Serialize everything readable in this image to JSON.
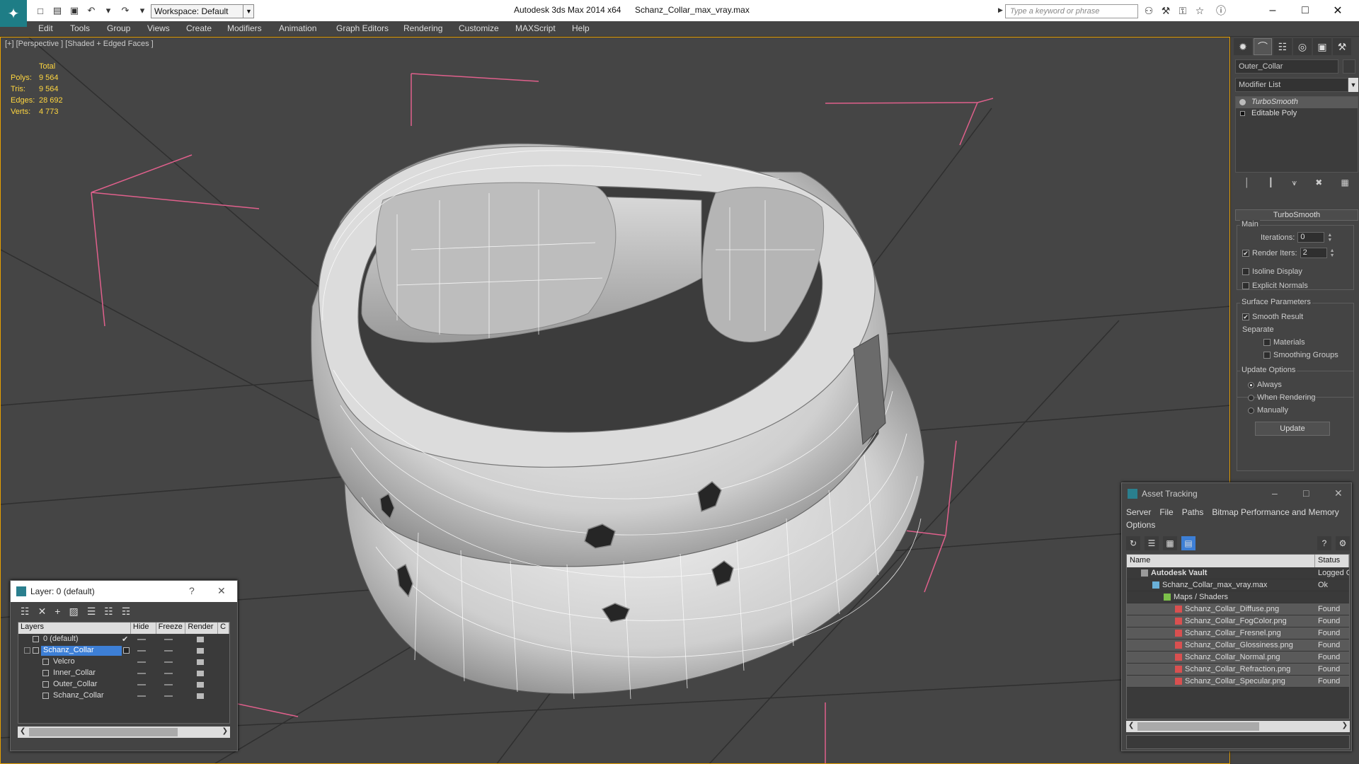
{
  "titlebar": {
    "workspace": "Workspace: Default",
    "app_title": "Autodesk 3ds Max  2014 x64",
    "file_title": "Schanz_Collar_max_vray.max",
    "search_placeholder": "Type a keyword or phrase"
  },
  "menu": [
    "Edit",
    "Tools",
    "Group",
    "Views",
    "Create",
    "Modifiers",
    "Animation",
    "Graph Editors",
    "Rendering",
    "Customize",
    "MAXScript",
    "Help"
  ],
  "viewport": {
    "label": "[+] [Perspective ] [Shaded + Edged Faces ]",
    "stats": {
      "header": "Total",
      "rows": [
        {
          "k": "Polys:",
          "v": "9 564"
        },
        {
          "k": "Tris:",
          "v": "9 564"
        },
        {
          "k": "Edges:",
          "v": "28 692"
        },
        {
          "k": "Verts:",
          "v": "4 773"
        }
      ]
    }
  },
  "command_panel": {
    "object_name": "Outer_Collar",
    "modifier_list": "Modifier List",
    "stack": [
      {
        "label": "TurboSmooth",
        "selected": true
      },
      {
        "label": "Editable Poly",
        "selected": false
      }
    ],
    "turbosmooth": {
      "header": "TurboSmooth",
      "main_label": "Main",
      "iterations_label": "Iterations:",
      "iterations_value": "0",
      "render_iters_label": "Render Iters:",
      "render_iters_value": "2",
      "isoline_label": "Isoline Display",
      "explicit_label": "Explicit Normals",
      "surface_label": "Surface Parameters",
      "smooth_label": "Smooth Result",
      "separate_label": "Separate",
      "materials_label": "Materials",
      "smoothing_groups_label": "Smoothing Groups",
      "update_options_label": "Update Options",
      "always_label": "Always",
      "when_rendering_label": "When Rendering",
      "manually_label": "Manually",
      "update_button": "Update"
    }
  },
  "layer_window": {
    "title": "Layer: 0 (default)",
    "headers": [
      "Layers",
      "Hide",
      "Freeze",
      "Render",
      "C"
    ],
    "rows": [
      {
        "name": "0 (default)",
        "indent": 0,
        "selected": false
      },
      {
        "name": "Schanz_Collar",
        "indent": 0,
        "selected": true
      },
      {
        "name": "Velcro",
        "indent": 1,
        "selected": false
      },
      {
        "name": "Inner_Collar",
        "indent": 1,
        "selected": false
      },
      {
        "name": "Outer_Collar",
        "indent": 1,
        "selected": false
      },
      {
        "name": "Schanz_Collar",
        "indent": 1,
        "selected": false
      }
    ]
  },
  "asset_window": {
    "title": "Asset Tracking",
    "menu": [
      "Server",
      "File",
      "Paths",
      "Bitmap Performance and Memory",
      "Options"
    ],
    "headers": [
      "Name",
      "Status"
    ],
    "rows": [
      {
        "name": "Autodesk Vault",
        "status": "Logged Out",
        "indent": 0
      },
      {
        "name": "Schanz_Collar_max_vray.max",
        "status": "Ok",
        "indent": 1
      },
      {
        "name": "Maps / Shaders",
        "status": "",
        "indent": 2
      },
      {
        "name": "Schanz_Collar_Diffuse.png",
        "status": "Found",
        "indent": 3
      },
      {
        "name": "Schanz_Collar_FogColor.png",
        "status": "Found",
        "indent": 3
      },
      {
        "name": "Schanz_Collar_Fresnel.png",
        "status": "Found",
        "indent": 3
      },
      {
        "name": "Schanz_Collar_Glossiness.png",
        "status": "Found",
        "indent": 3
      },
      {
        "name": "Schanz_Collar_Normal.png",
        "status": "Found",
        "indent": 3
      },
      {
        "name": "Schanz_Collar_Refraction.png",
        "status": "Found",
        "indent": 3
      },
      {
        "name": "Schanz_Collar_Specular.png",
        "status": "Found",
        "indent": 3
      }
    ]
  }
}
